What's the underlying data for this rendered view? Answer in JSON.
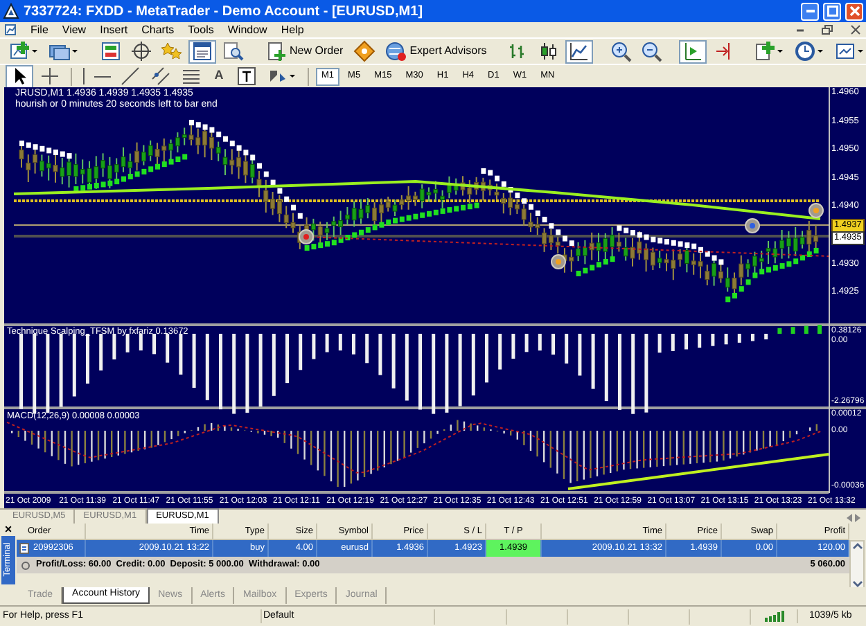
{
  "window": {
    "title": "7337724: FXDD - MetaTrader - Demo Account - [EURUSD,M1]"
  },
  "menu": [
    "File",
    "View",
    "Insert",
    "Charts",
    "Tools",
    "Window",
    "Help"
  ],
  "toolbar": [
    {
      "kind": "icon",
      "pressed": false
    },
    {
      "kind": "icon",
      "pressed": false
    },
    {
      "kind": "separator"
    },
    {
      "kind": "icon",
      "pressed": false
    },
    {
      "kind": "icon",
      "pressed": false
    },
    {
      "kind": "icon",
      "pressed": false
    },
    {
      "kind": "icon",
      "pressed": true
    },
    {
      "kind": "icon",
      "pressed": false
    },
    {
      "kind": "separator"
    },
    {
      "kind": "button",
      "label": "New Order",
      "pressed": false
    },
    {
      "kind": "icon",
      "pressed": false
    },
    {
      "kind": "button",
      "label": "Expert Advisors",
      "pressed": false
    },
    {
      "kind": "separator"
    },
    {
      "kind": "icon",
      "pressed": false
    },
    {
      "kind": "icon",
      "pressed": false
    },
    {
      "kind": "icon",
      "pressed": true
    },
    {
      "kind": "separator"
    },
    {
      "kind": "icon",
      "pressed": false
    },
    {
      "kind": "icon",
      "pressed": false
    },
    {
      "kind": "separator"
    },
    {
      "kind": "icon",
      "pressed": true
    },
    {
      "kind": "icon",
      "pressed": false
    },
    {
      "kind": "separator"
    },
    {
      "kind": "icon",
      "pressed": false
    },
    {
      "kind": "icon",
      "pressed": false
    },
    {
      "kind": "icon",
      "pressed": false
    }
  ],
  "drawing_toolbar": [
    {
      "kind": "icon",
      "pressed": true
    },
    {
      "kind": "icon",
      "pressed": false
    },
    {
      "kind": "separator"
    },
    {
      "kind": "icon",
      "pressed": false
    },
    {
      "kind": "icon",
      "pressed": false
    },
    {
      "kind": "icon",
      "pressed": false
    },
    {
      "kind": "icon",
      "pressed": false
    },
    {
      "kind": "icon",
      "pressed": false
    },
    {
      "kind": "glyph",
      "label": "A",
      "pressed": false
    },
    {
      "kind": "icon",
      "pressed": false
    },
    {
      "kind": "icon",
      "pressed": false
    },
    {
      "kind": "separator"
    },
    {
      "kind": "period",
      "label": "M1",
      "selected": true
    },
    {
      "kind": "period",
      "label": "M5",
      "selected": false
    },
    {
      "kind": "period",
      "label": "M15",
      "selected": false
    },
    {
      "kind": "period",
      "label": "M30",
      "selected": false
    },
    {
      "kind": "period",
      "label": "H1",
      "selected": false
    },
    {
      "kind": "period",
      "label": "H4",
      "selected": false
    },
    {
      "kind": "period",
      "label": "D1",
      "selected": false
    },
    {
      "kind": "period",
      "label": "W1",
      "selected": false
    },
    {
      "kind": "period",
      "label": "MN",
      "selected": false
    }
  ],
  "chart": {
    "info_lines": [
      "JRUSD,M1  1.4936 1.4939 1.4935 1.4935",
      "hourish or 0 minutes 20 seconds left to bar end"
    ],
    "indicator_label": "Technique Scalping_TFSM by fxfariz 0.13672",
    "macd_label": "MACD(12,26,9) 0.00008 0.00003",
    "price_axis": [
      {
        "label": "1.4960",
        "kind": "tick"
      },
      {
        "label": "1.4955",
        "kind": "tick"
      },
      {
        "label": "1.4950",
        "kind": "tick"
      },
      {
        "label": "1.4945",
        "kind": "tick"
      },
      {
        "label": "1.4940",
        "kind": "tick"
      },
      {
        "label": "1.4937",
        "kind": "ask"
      },
      {
        "label": "1.4935",
        "kind": "bid"
      },
      {
        "label": "1.4930",
        "kind": "tick"
      },
      {
        "label": "1.4925",
        "kind": "tick"
      }
    ],
    "indicator_axis": [
      "0.38126",
      "0.00",
      "-2.26796"
    ],
    "macd_axis": [
      "0.00012",
      "0.00",
      "-0.00036"
    ],
    "time_axis": [
      "21 Oct 2009",
      "21 Oct 11:39",
      "21 Oct 11:47",
      "21 Oct 11:55",
      "21 Oct 12:03",
      "21 Oct 12:11",
      "21 Oct 12:19",
      "21 Oct 12:27",
      "21 Oct 12:35",
      "21 Oct 12:43",
      "21 Oct 12:51",
      "21 Oct 12:59",
      "21 Oct 13:07",
      "21 Oct 13:15",
      "21 Oct 13:23",
      "21 Oct 13:32"
    ]
  },
  "chart_tabs": [
    {
      "label": "EURUSD,M5",
      "selected": false
    },
    {
      "label": "EURUSD,M1",
      "selected": false
    },
    {
      "label": "EURUSD,M1",
      "selected": true
    }
  ],
  "terminal": {
    "title": "Terminal",
    "close": "×",
    "columns": [
      "Order",
      "Time",
      "Type",
      "Size",
      "Symbol",
      "Price",
      "S / L",
      "T / P",
      "Time",
      "Price",
      "Swap",
      "Profit"
    ],
    "rows": [
      {
        "selected": true,
        "cells": [
          {
            "text": "20992306",
            "highlighted": false
          },
          {
            "text": "2009.10.21 13:22",
            "highlighted": false
          },
          {
            "text": "buy",
            "highlighted": false
          },
          {
            "text": "4.00",
            "highlighted": false
          },
          {
            "text": "eurusd",
            "highlighted": false
          },
          {
            "text": "1.4936",
            "highlighted": false
          },
          {
            "text": "1.4923",
            "highlighted": false
          },
          {
            "text": "1.4939",
            "highlighted": true
          },
          {
            "text": "2009.10.21 13:32",
            "highlighted": false
          },
          {
            "text": "1.4939",
            "highlighted": false
          },
          {
            "text": "0.00",
            "highlighted": false
          },
          {
            "text": "120.00",
            "highlighted": false
          }
        ]
      }
    ],
    "summary": {
      "text": "Profit/Loss: 60.00  Credit: 0.00  Deposit: 5 000.00  Withdrawal: 0.00",
      "total": "5 060.00"
    },
    "tabs": [
      {
        "label": "Trade",
        "selected": false
      },
      {
        "label": "Account History",
        "selected": true
      },
      {
        "label": "News",
        "selected": false
      },
      {
        "label": "Alerts",
        "selected": false
      },
      {
        "label": "Mailbox",
        "selected": false
      },
      {
        "label": "Experts",
        "selected": false
      },
      {
        "label": "Journal",
        "selected": false
      }
    ]
  },
  "status_bar": [
    "For Help, press F1",
    "Default",
    "1039/5 kb"
  ]
}
